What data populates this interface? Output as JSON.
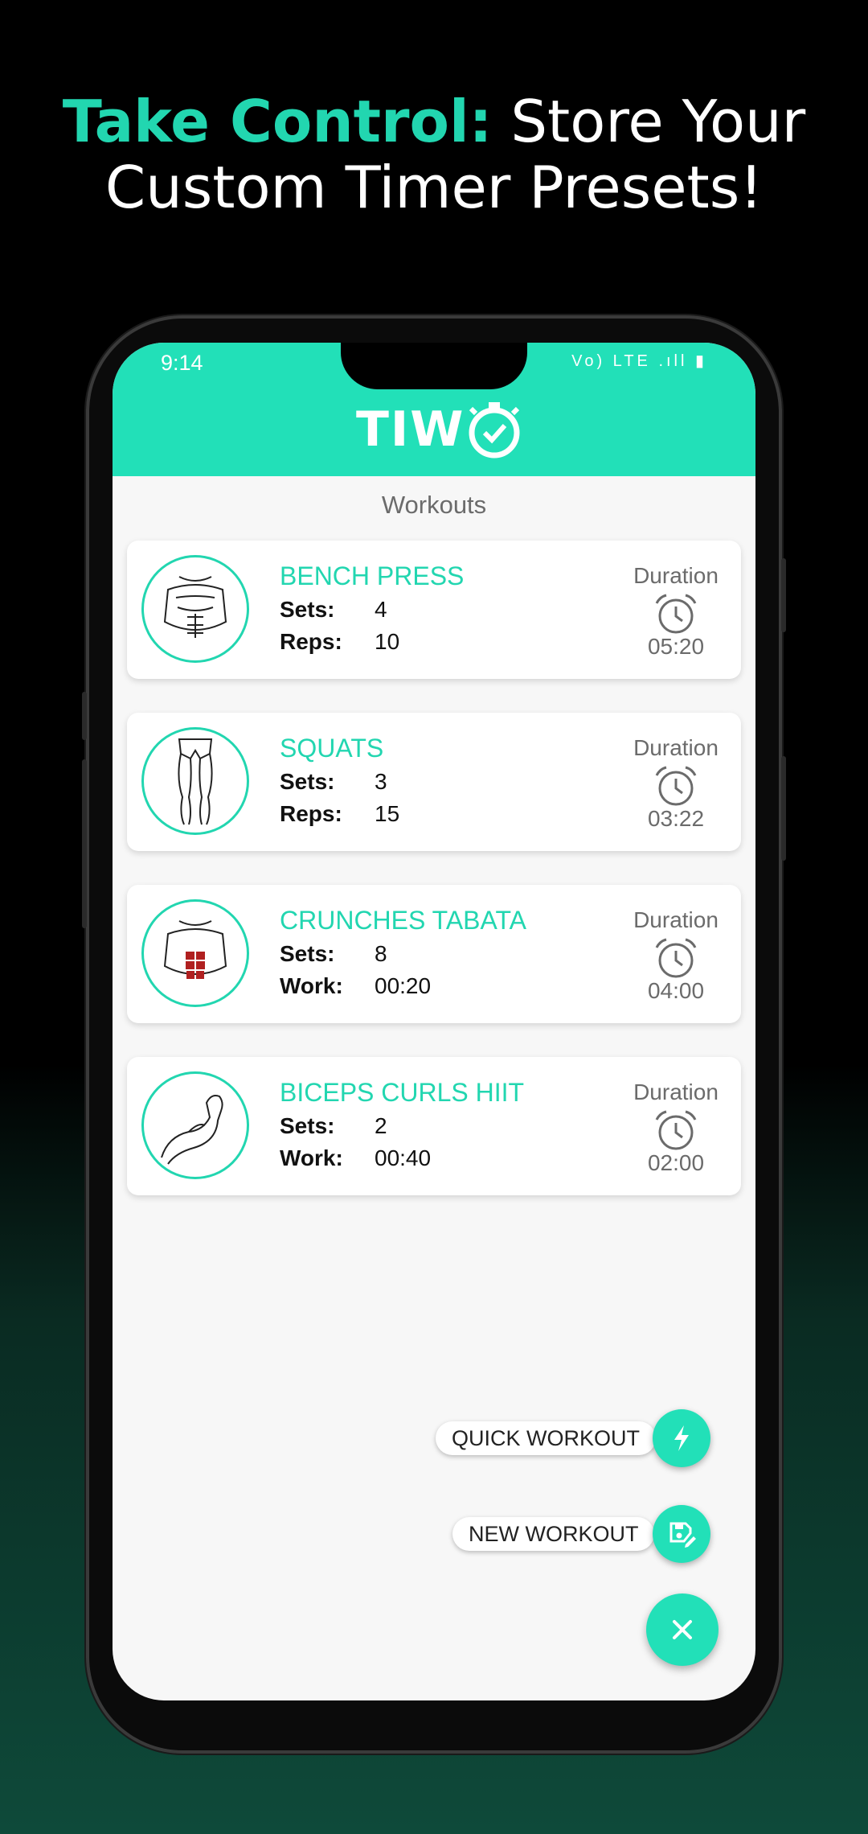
{
  "headline": {
    "accent": "Take Control:",
    "rest_line1": " Store Your",
    "line2": "Custom Timer Presets!"
  },
  "status_bar": {
    "time": "9:14",
    "icons": "Vo) LTE .ıll ▮"
  },
  "app": {
    "logo_text": "TIW",
    "section_title": "Workouts"
  },
  "workouts": [
    {
      "name": "BENCH PRESS",
      "label1": "Sets:",
      "value1": "4",
      "label2": "Reps:",
      "value2": "10",
      "duration_label": "Duration",
      "duration": "05:20",
      "image": "chest-muscles"
    },
    {
      "name": "SQUATS",
      "label1": "Sets:",
      "value1": "3",
      "label2": "Reps:",
      "value2": "15",
      "duration_label": "Duration",
      "duration": "03:22",
      "image": "legs"
    },
    {
      "name": "CRUNCHES TABATA",
      "label1": "Sets:",
      "value1": "8",
      "label2": "Work:",
      "value2": "00:20",
      "duration_label": "Duration",
      "duration": "04:00",
      "image": "abs"
    },
    {
      "name": "BICEPS CURLS HIIT",
      "label1": "Sets:",
      "value1": "2",
      "label2": "Work:",
      "value2": "00:40",
      "duration_label": "Duration",
      "duration": "02:00",
      "image": "bicep-arm"
    }
  ],
  "fab_menu": {
    "quick_workout": "QUICK WORKOUT",
    "new_workout": "NEW WORKOUT",
    "close_icon": "close-icon"
  },
  "colors": {
    "accent": "#22d6b0",
    "appbar": "#22e0b8",
    "background": "#000000"
  }
}
